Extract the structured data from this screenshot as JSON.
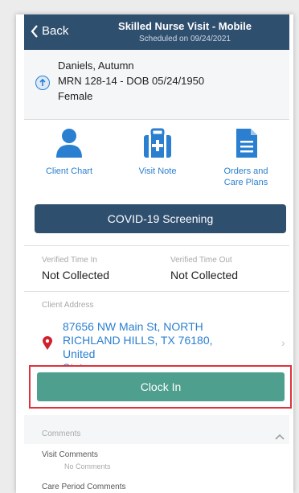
{
  "header": {
    "back_label": "Back",
    "title": "Skilled Nurse Visit - Mobile",
    "subtitle": "Scheduled on 09/24/2021"
  },
  "patient": {
    "name": "Daniels, Autumn",
    "mrn_dob": "MRN 128-14 - DOB 05/24/1950",
    "gender": "Female"
  },
  "tiles": [
    {
      "label": "Client Chart",
      "icon": "person-icon"
    },
    {
      "label": "Visit Note",
      "icon": "medical-kit-icon"
    },
    {
      "label_line1": "Orders and",
      "label_line2": "Care Plans",
      "icon": "document-icon"
    }
  ],
  "covid_button": "COVID-19 Screening",
  "times": {
    "in_label": "Verified Time In",
    "in_value": "Not Collected",
    "out_label": "Verified Time Out",
    "out_value": "Not Collected"
  },
  "address": {
    "label": "Client Address",
    "line1": "87656 NW Main St, NORTH",
    "line2": "RICHLAND HILLS, TX 76180, United",
    "line3": "States"
  },
  "clock_in_button": "Clock In",
  "comments": {
    "header": "Comments",
    "visit_label": "Visit Comments",
    "visit_value": "No Comments",
    "care_period_label": "Care Period Comments"
  },
  "colors": {
    "header_bg": "#2f4f6f",
    "link_blue": "#2a7fd0",
    "clock_green": "#4e9f8e",
    "highlight_red": "#e0323a",
    "pin_red": "#d0202a"
  }
}
